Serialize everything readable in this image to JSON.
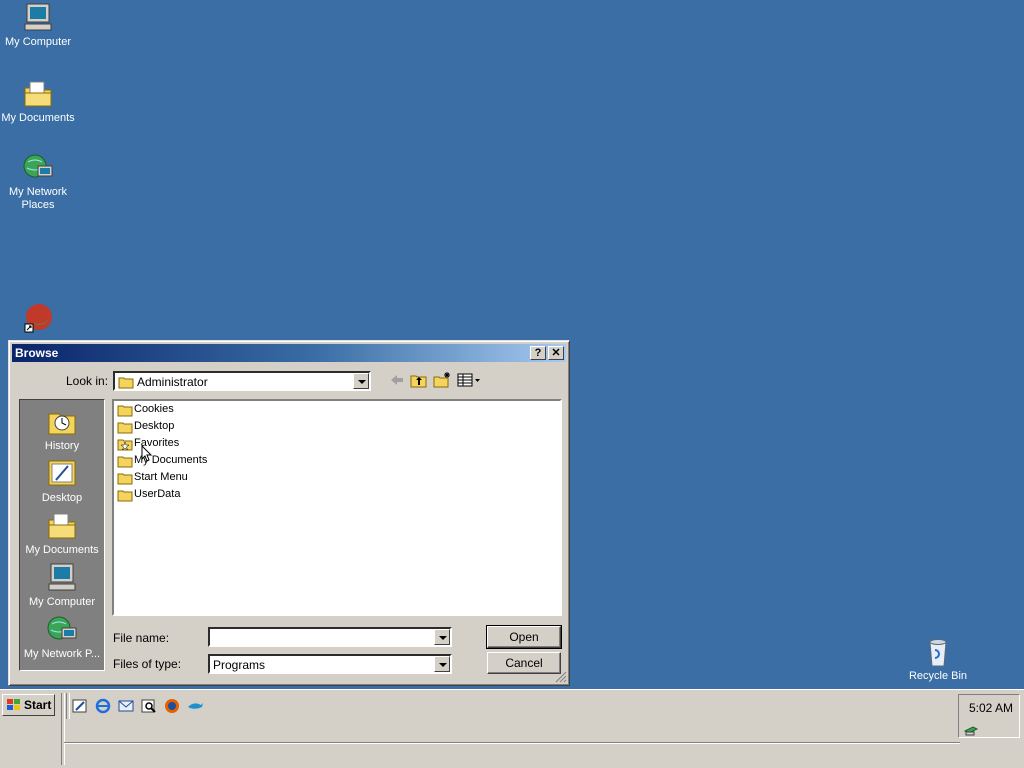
{
  "desktop": {
    "icons": [
      {
        "label": "My Computer",
        "icon": "my-computer-icon"
      },
      {
        "label": "My Documents",
        "icon": "my-documents-icon"
      },
      {
        "label": "My Network Places",
        "icon": "network-places-icon"
      },
      {
        "label": "",
        "icon": "shortcut-app-icon"
      },
      {
        "label": "Recycle Bin",
        "icon": "recycle-bin-icon"
      }
    ]
  },
  "dialog": {
    "title": "Browse",
    "help_glyph": "?",
    "close_glyph": "✕",
    "look_in_label": "Look in:",
    "look_in_value": "Administrator",
    "places": [
      {
        "label": "History",
        "icon": "history-icon"
      },
      {
        "label": "Desktop",
        "icon": "desktop-icon"
      },
      {
        "label": "My Documents",
        "icon": "my-documents-icon"
      },
      {
        "label": "My Computer",
        "icon": "my-computer-icon"
      },
      {
        "label": "My Network P...",
        "icon": "network-places-icon"
      }
    ],
    "files": [
      {
        "name": "Cookies",
        "icon": "folder-icon"
      },
      {
        "name": "Desktop",
        "icon": "folder-icon"
      },
      {
        "name": "Favorites",
        "icon": "favorites-folder-icon"
      },
      {
        "name": "My Documents",
        "icon": "folder-icon"
      },
      {
        "name": "Start Menu",
        "icon": "folder-icon"
      },
      {
        "name": "UserData",
        "icon": "folder-icon"
      }
    ],
    "file_name_label": "File name:",
    "file_name_value": "",
    "files_of_type_label": "Files of type:",
    "files_of_type_value": "Programs",
    "open_label": "Open",
    "cancel_label": "Cancel"
  },
  "taskbar": {
    "start_label": "Start",
    "clock": "5:02 AM",
    "quick_launch": [
      "show-desktop-icon",
      "internet-explorer-icon",
      "outlook-icon",
      "search-icon",
      "firefox-icon",
      "dolphin-app-icon"
    ]
  },
  "colors": {
    "desktop": "#3a6ea5",
    "titlebar_start": "#0a246a",
    "face": "#d4d0c8"
  }
}
